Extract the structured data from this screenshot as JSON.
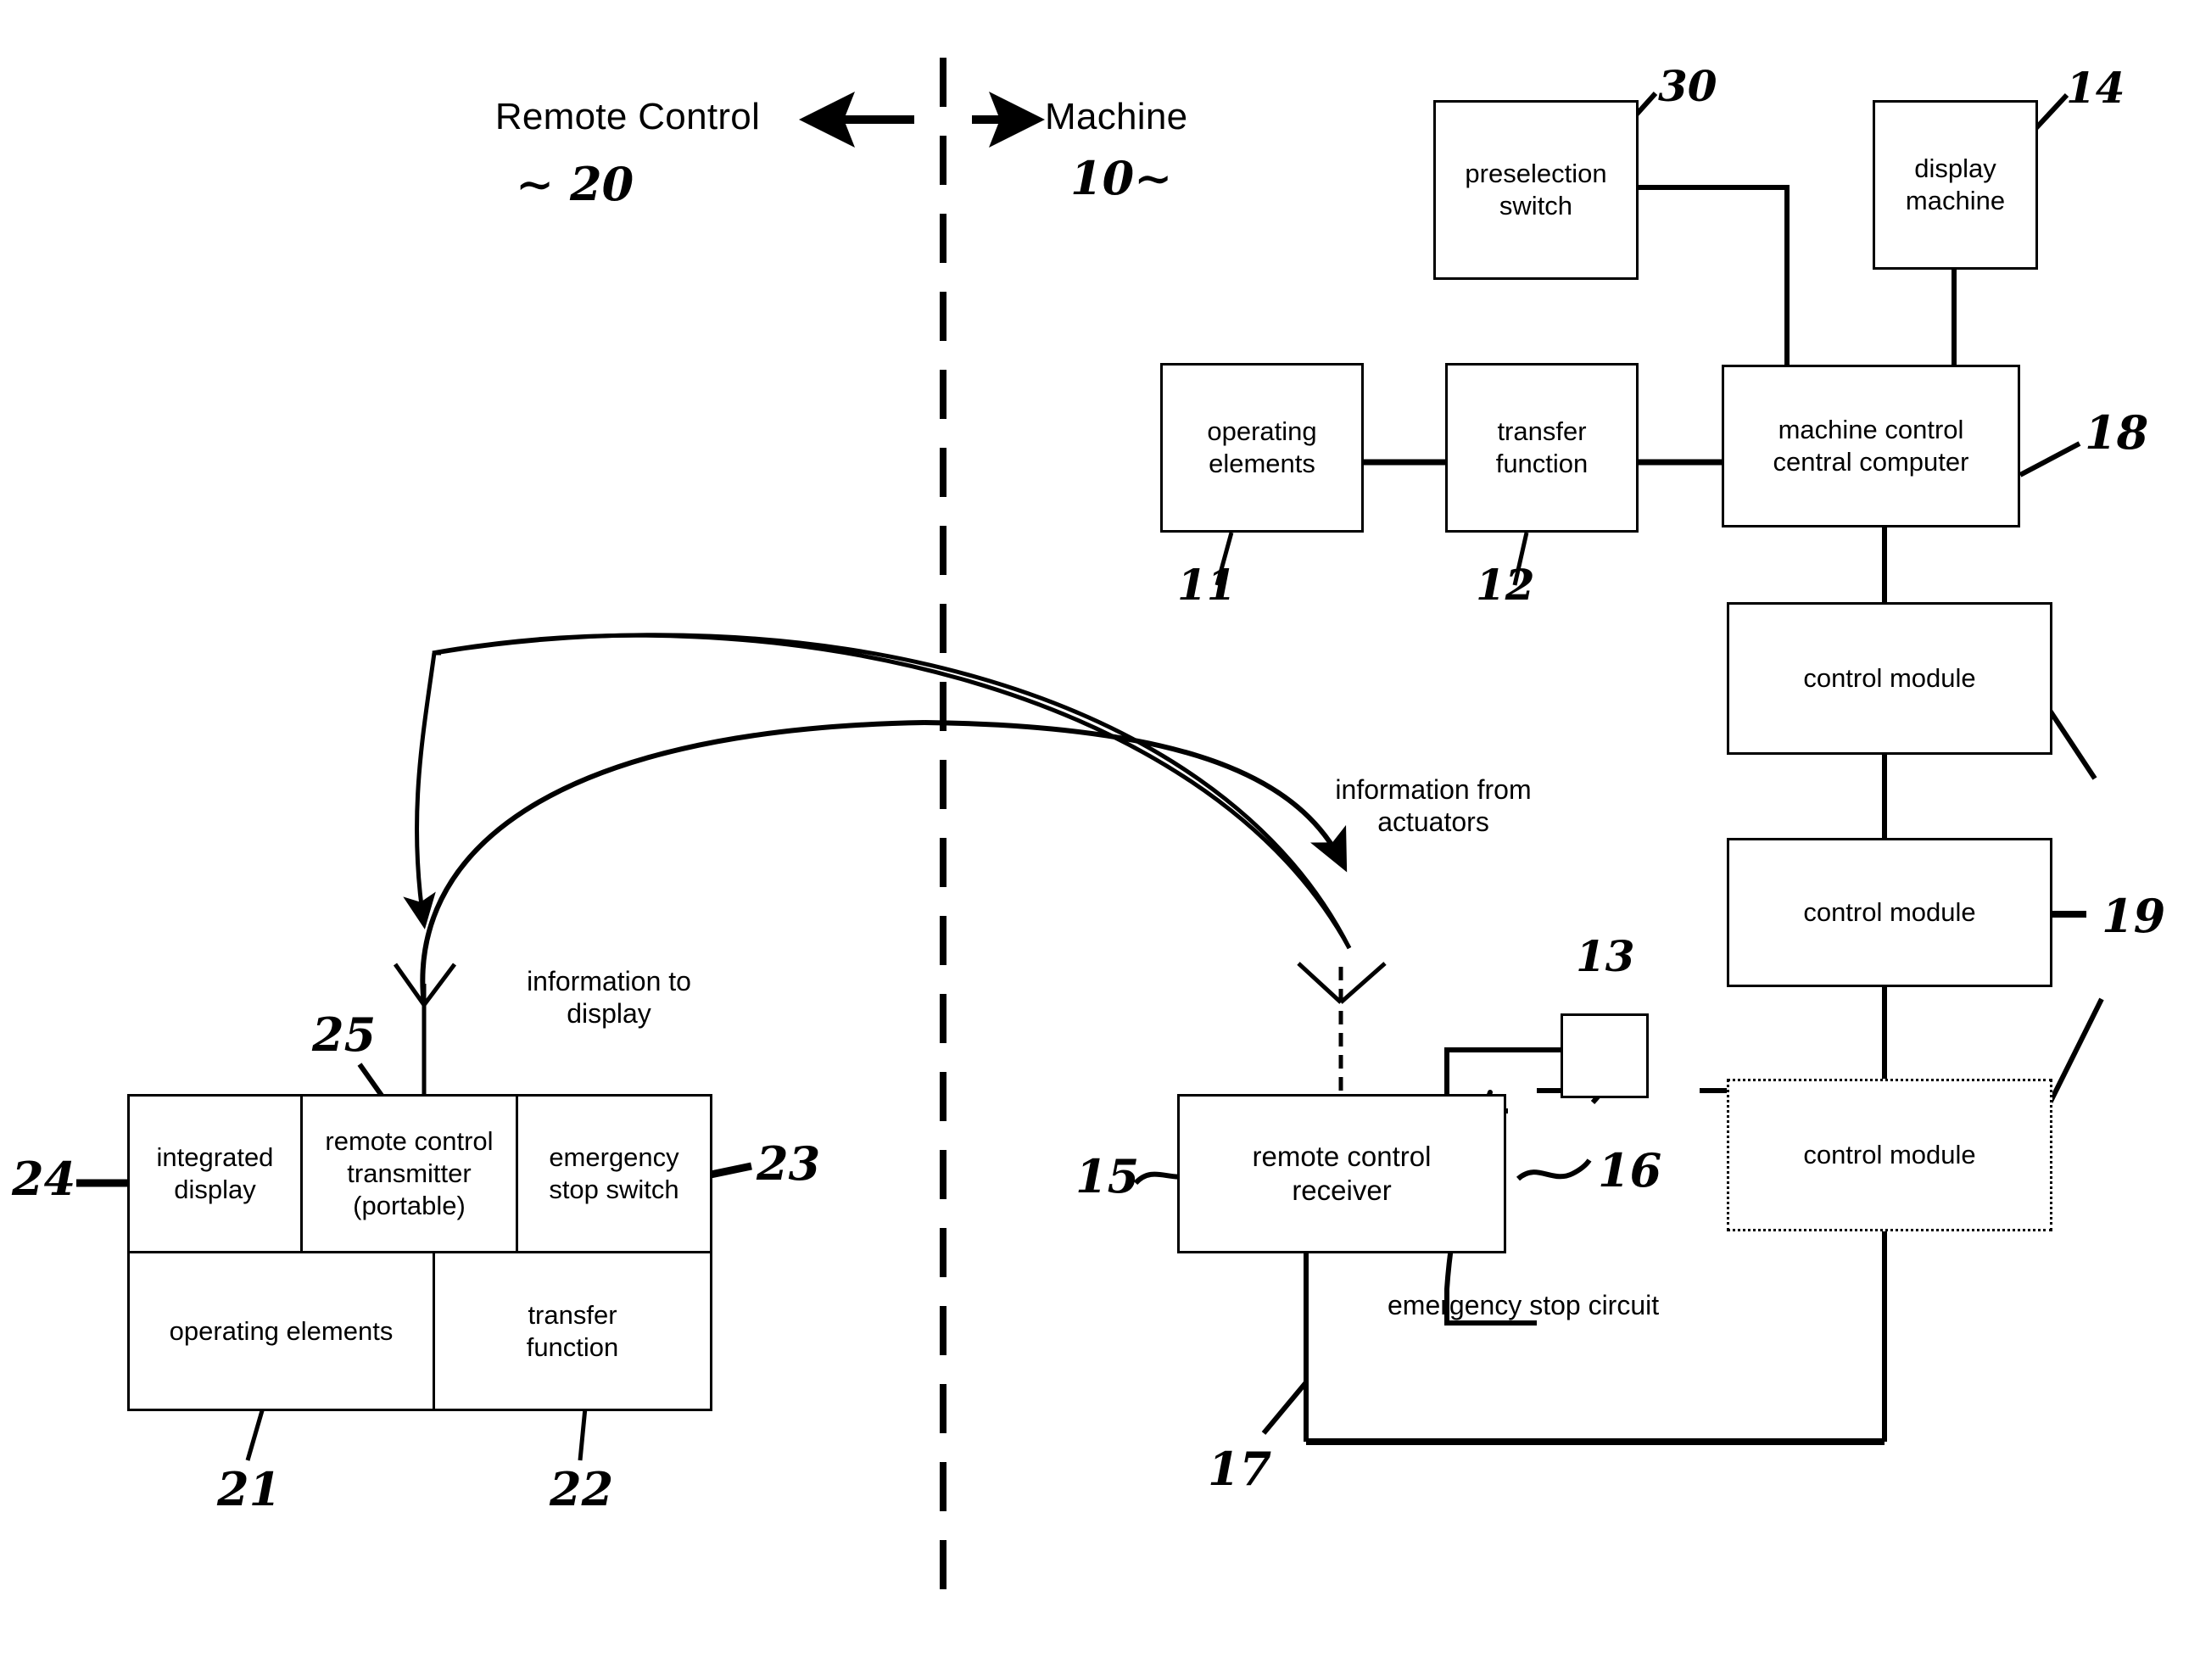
{
  "figure": {
    "side_labels": {
      "left": "Remote Control",
      "right": "Machine",
      "left_ref": "∼ 20",
      "right_ref": "10∼"
    },
    "signal_labels": {
      "to_display": "information to\ndisplay",
      "from_actuators": "information from\nactuators",
      "emergency_stop_circuit": "emergency stop circuit"
    }
  },
  "machine_side": {
    "boxes": [
      {
        "id": "preselection_switch",
        "label": "preselection\nswitch",
        "ref": "30"
      },
      {
        "id": "display_machine",
        "label": "display\nmachine",
        "ref": "14"
      },
      {
        "id": "operating_elements",
        "label": "operating\nelements",
        "ref": "11"
      },
      {
        "id": "transfer_function",
        "label": "transfer\nfunction",
        "ref": "12"
      },
      {
        "id": "machine_control_central_computer",
        "label": "machine control\ncentral computer",
        "ref": "18"
      },
      {
        "id": "control_module_1",
        "label": "control module",
        "ref": ""
      },
      {
        "id": "control_module_2",
        "label": "control module",
        "ref": "19"
      },
      {
        "id": "control_module_3",
        "label": "control module",
        "ref": ""
      },
      {
        "id": "remote_control_receiver",
        "label": "remote control\nreceiver",
        "ref": "15"
      },
      {
        "id": "actuator_block",
        "label": "",
        "ref": "13"
      }
    ],
    "refs": {
      "receiver_left": "15",
      "receiver_right": "16",
      "receiver_bottom": "17",
      "actuator": "13",
      "control_module_group": "19",
      "central_computer": "18",
      "operating_elements": "11",
      "transfer_function": "12",
      "preselection_switch": "30",
      "display_machine": "14"
    }
  },
  "remote_side": {
    "boxes": [
      {
        "id": "integrated_display",
        "label": "integrated\ndisplay",
        "ref": "24"
      },
      {
        "id": "remote_control_transmitter",
        "label": "remote control\ntransmitter\n(portable)",
        "ref": "25"
      },
      {
        "id": "emergency_stop_switch",
        "label": "emergency\nstop switch",
        "ref": "23"
      },
      {
        "id": "operating_elements",
        "label": "operating elements",
        "ref": "21"
      },
      {
        "id": "transfer_function",
        "label": "transfer\nfunction",
        "ref": "22"
      }
    ],
    "refs": {
      "integrated_display": "24",
      "transmitter": "25",
      "emergency_stop_switch": "23",
      "operating_elements": "21",
      "transfer_function": "22"
    }
  },
  "colors": {
    "ink": "#000000",
    "paper": "#ffffff"
  }
}
